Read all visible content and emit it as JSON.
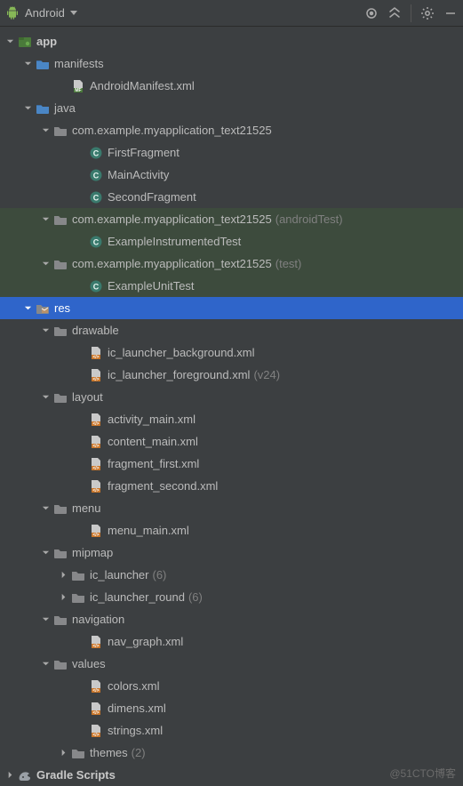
{
  "toolbar": {
    "view_label": "Android"
  },
  "watermark": "@51CTO博客",
  "tree": [
    {
      "depth": 0,
      "exp": "down",
      "icon": "module",
      "label": "app",
      "bold": true
    },
    {
      "depth": 1,
      "exp": "down",
      "icon": "folder-blue",
      "label": "manifests"
    },
    {
      "depth": 3,
      "exp": "none",
      "icon": "xml-mf",
      "label": "AndroidManifest.xml"
    },
    {
      "depth": 1,
      "exp": "down",
      "icon": "folder-blue",
      "label": "java"
    },
    {
      "depth": 2,
      "exp": "down",
      "icon": "package",
      "label": "com.example.myapplication_text21525"
    },
    {
      "depth": 4,
      "exp": "none",
      "icon": "class",
      "label": "FirstFragment"
    },
    {
      "depth": 4,
      "exp": "none",
      "icon": "class",
      "label": "MainActivity"
    },
    {
      "depth": 4,
      "exp": "none",
      "icon": "class",
      "label": "SecondFragment"
    },
    {
      "depth": 2,
      "exp": "down",
      "icon": "package",
      "label": "com.example.myapplication_text21525",
      "suffix": "(androidTest)",
      "test": true
    },
    {
      "depth": 4,
      "exp": "none",
      "icon": "class",
      "label": "ExampleInstrumentedTest",
      "test": true
    },
    {
      "depth": 2,
      "exp": "down",
      "icon": "package",
      "label": "com.example.myapplication_text21525",
      "suffix": "(test)",
      "test": true
    },
    {
      "depth": 4,
      "exp": "none",
      "icon": "class",
      "label": "ExampleUnitTest",
      "test": true
    },
    {
      "depth": 1,
      "exp": "down",
      "icon": "folder-res",
      "label": "res",
      "selected": true
    },
    {
      "depth": 2,
      "exp": "down",
      "icon": "package",
      "label": "drawable"
    },
    {
      "depth": 4,
      "exp": "none",
      "icon": "xml-orange",
      "label": "ic_launcher_background.xml"
    },
    {
      "depth": 4,
      "exp": "none",
      "icon": "xml-orange",
      "label": "ic_launcher_foreground.xml",
      "suffix": "(v24)"
    },
    {
      "depth": 2,
      "exp": "down",
      "icon": "package",
      "label": "layout"
    },
    {
      "depth": 4,
      "exp": "none",
      "icon": "xml-orange",
      "label": "activity_main.xml"
    },
    {
      "depth": 4,
      "exp": "none",
      "icon": "xml-orange",
      "label": "content_main.xml"
    },
    {
      "depth": 4,
      "exp": "none",
      "icon": "xml-orange",
      "label": "fragment_first.xml"
    },
    {
      "depth": 4,
      "exp": "none",
      "icon": "xml-orange",
      "label": "fragment_second.xml"
    },
    {
      "depth": 2,
      "exp": "down",
      "icon": "package",
      "label": "menu"
    },
    {
      "depth": 4,
      "exp": "none",
      "icon": "xml-orange",
      "label": "menu_main.xml"
    },
    {
      "depth": 2,
      "exp": "down",
      "icon": "package",
      "label": "mipmap"
    },
    {
      "depth": 3,
      "exp": "right",
      "icon": "package",
      "label": "ic_launcher",
      "suffix": "(6)"
    },
    {
      "depth": 3,
      "exp": "right",
      "icon": "package",
      "label": "ic_launcher_round",
      "suffix": "(6)"
    },
    {
      "depth": 2,
      "exp": "down",
      "icon": "package",
      "label": "navigation"
    },
    {
      "depth": 4,
      "exp": "none",
      "icon": "xml-orange",
      "label": "nav_graph.xml"
    },
    {
      "depth": 2,
      "exp": "down",
      "icon": "package",
      "label": "values"
    },
    {
      "depth": 4,
      "exp": "none",
      "icon": "xml-orange",
      "label": "colors.xml"
    },
    {
      "depth": 4,
      "exp": "none",
      "icon": "xml-orange",
      "label": "dimens.xml"
    },
    {
      "depth": 4,
      "exp": "none",
      "icon": "xml-orange",
      "label": "strings.xml"
    },
    {
      "depth": 3,
      "exp": "right",
      "icon": "package",
      "label": "themes",
      "suffix": "(2)"
    },
    {
      "depth": 0,
      "exp": "right",
      "icon": "gradle",
      "label": "Gradle Scripts",
      "bold": true
    }
  ]
}
